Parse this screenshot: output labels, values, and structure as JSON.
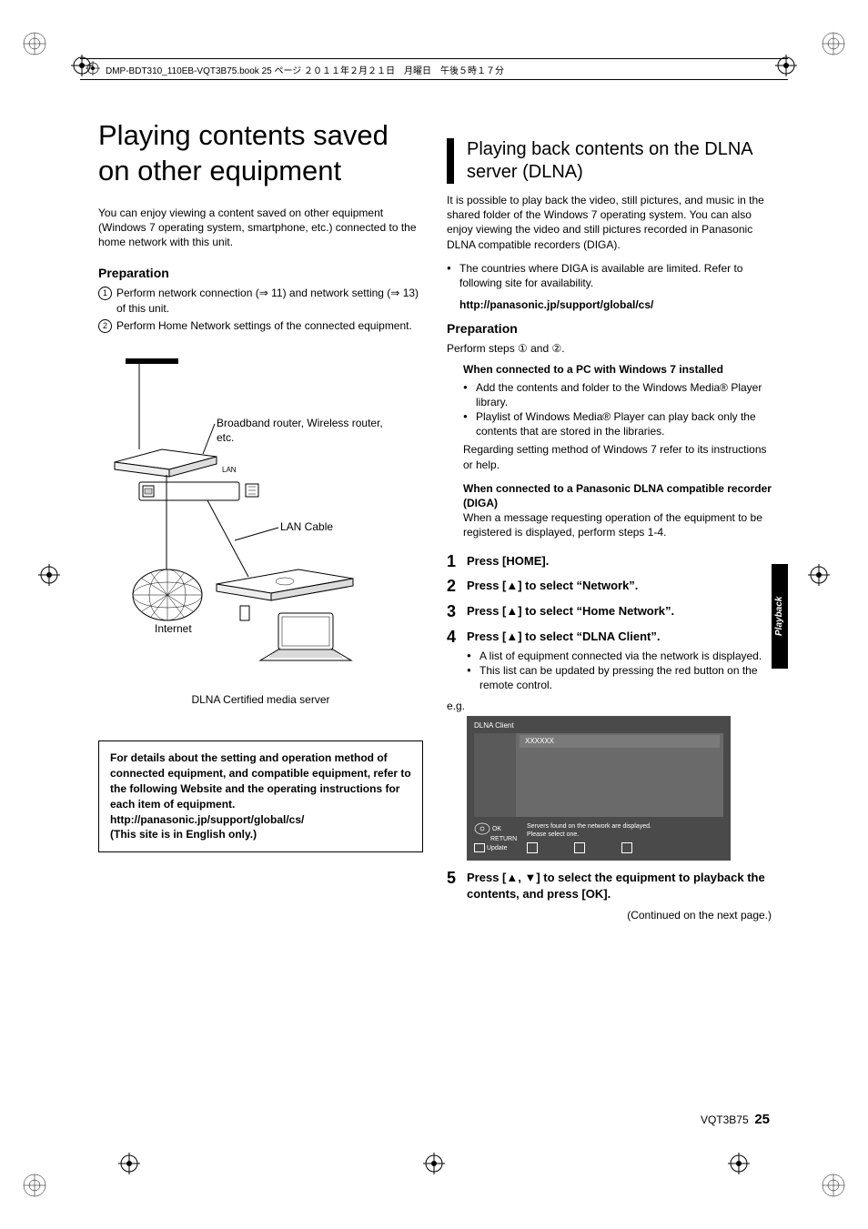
{
  "header_line": "DMP-BDT310_110EB-VQT3B75.book  25 ページ  ２０１１年２月２１日　月曜日　午後５時１７分",
  "left": {
    "title": "Playing contents saved on other equipment",
    "intro": "You can enjoy viewing a content saved on other equipment (Windows 7 operating system, smartphone, etc.) connected to the home network with this unit.",
    "prep_h": "Preparation",
    "prep1": "Perform network connection (⇒ 11) and network setting (⇒ 13) of this unit.",
    "prep2": "Perform Home Network settings of the connected equipment.",
    "diagram": {
      "router": "Broadband router, Wireless router, etc.",
      "lan": "LAN",
      "lancable": "LAN Cable",
      "internet": "Internet",
      "caption": "DLNA Certified media server"
    },
    "note": "For details about the setting and operation method of connected equipment, and compatible equipment, refer to the following Website and the operating instructions for each item of equipment.\nhttp://panasonic.jp/support/global/cs/\n(This site is in English only.)"
  },
  "right": {
    "section_title": "Playing back contents on the DLNA server (DLNA)",
    "intro": "It is possible to play back the video, still pictures, and music in the shared folder of the Windows 7 operating system. You can also enjoy viewing the video and still pictures recorded in Panasonic DLNA compatible recorders (DIGA).",
    "avail_bullet": "The countries where DIGA is available are limited. Refer to following site for availability.",
    "avail_url": "http://panasonic.jp/support/global/cs/",
    "prep_h": "Preparation",
    "prep_intro": "Perform steps ① and ②.",
    "pc_h": "When connected to a PC with Windows 7 installed",
    "pc_b1": "Add the contents and folder to the Windows Media® Player library.",
    "pc_b2": "Playlist of Windows Media® Player can play back only the contents that are stored in the libraries.",
    "pc_note": "Regarding setting method of Windows 7 refer to its instructions or help.",
    "diga_h": "When connected to a Panasonic DLNA compatible recorder (DIGA)",
    "diga_p": "When a message requesting operation of the equipment to be registered is displayed, perform steps 1-4.",
    "steps": [
      "Press [HOME].",
      "Press [▲] to select “Network”.",
      "Press [▲] to select “Home Network”.",
      "Press [▲] to select “DLNA Client”."
    ],
    "step4_bullets": [
      "A list of equipment connected via the network is displayed.",
      "This list can be updated by pressing the red button on the remote control."
    ],
    "eg": "e.g.",
    "screen": {
      "title": "DLNA Client",
      "row": "XXXXXX",
      "leg_ok": "OK",
      "leg_return": "RETURN",
      "leg_update": "Update",
      "leg_msg": "Servers found on the network are displayed.\nPlease select one."
    },
    "step5": "Press [▲, ▼] to select the equipment to playback the contents, and press [OK].",
    "continued": "(Continued on the next page.)"
  },
  "side_tab": "Playback",
  "page_footer": {
    "code": "VQT3B75",
    "page": "25"
  }
}
